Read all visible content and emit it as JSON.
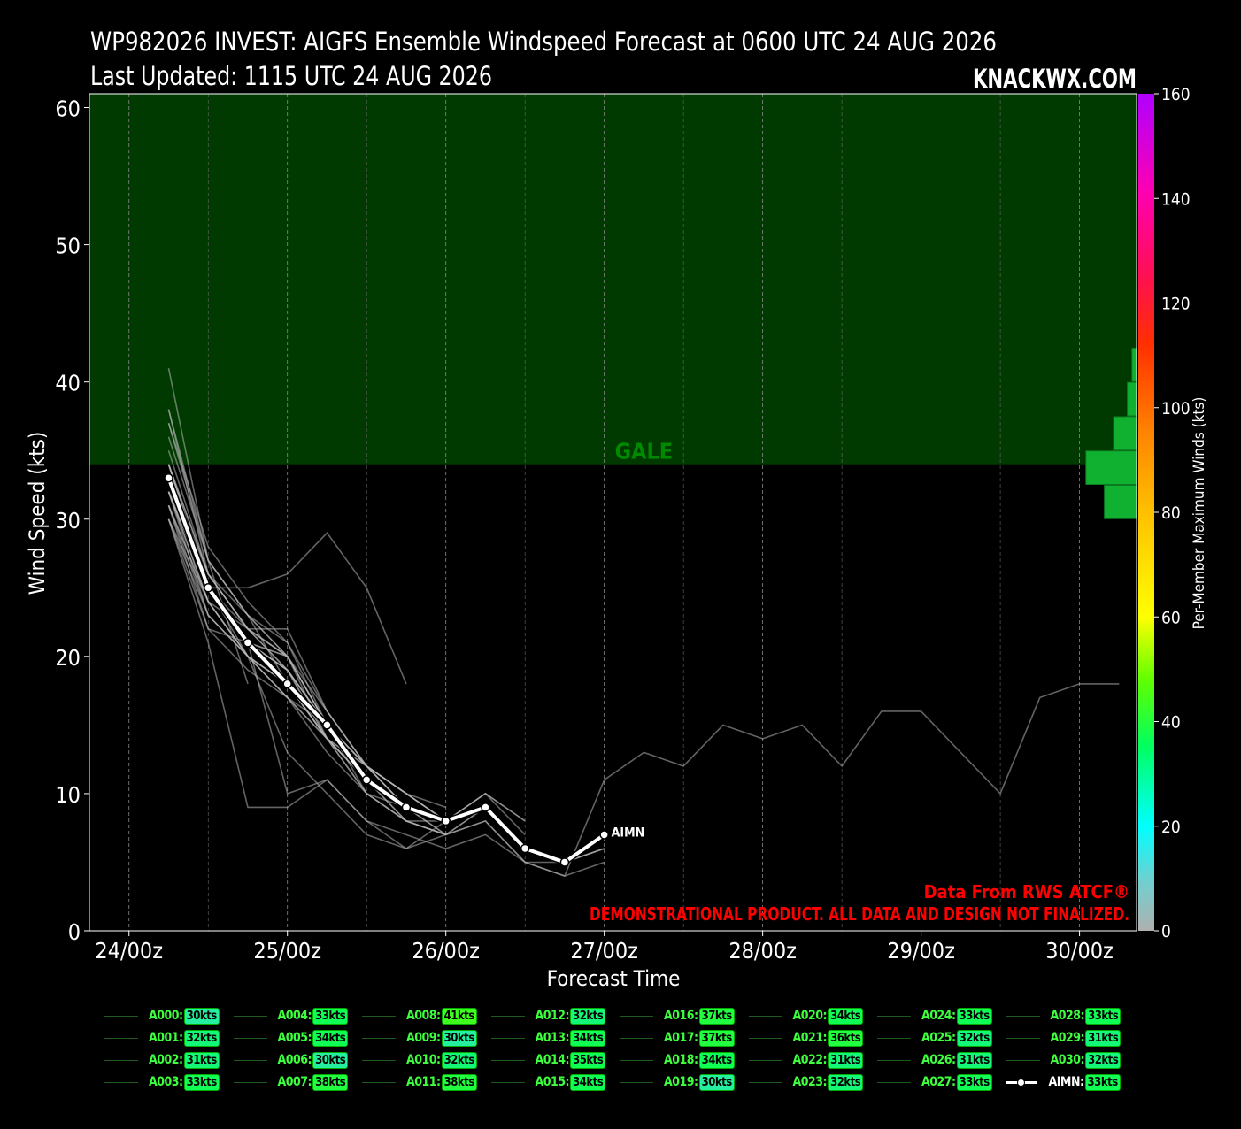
{
  "title_line1": "WP982026 INVEST: AIGFS Ensemble Windspeed Forecast at 0600 UTC 24 AUG 2026",
  "title_line2": "Last Updated: 1115 UTC 24 AUG 2026",
  "brand": "KNACKWX.COM",
  "watermark_line1": "Data From RWS ATCF®",
  "watermark_line2": "DEMONSTRATIONAL PRODUCT. ALL DATA AND DESIGN NOT FINALIZED.",
  "band_label": "GALE",
  "mean_label": "AIMN",
  "colors": {
    "gale_band": "#003a00",
    "gale_text": "#008a00",
    "watermark": "#ff0000",
    "member_line": "#b4b4b4",
    "mean_line": "#ffffff",
    "hist_bar": "#10b030"
  },
  "chart_data": {
    "type": "line",
    "xlabel": "Forecast Time",
    "ylabel": "Wind Speed (kts)",
    "xlim": [
      -0.25,
      6.36
    ],
    "ylim": [
      0,
      61
    ],
    "xticks": [
      0,
      1,
      2,
      3,
      4,
      5,
      6
    ],
    "xtick_labels": [
      "24/00z",
      "25/00z",
      "26/00z",
      "27/00z",
      "28/00z",
      "29/00z",
      "30/00z"
    ],
    "yticks": [
      0,
      10,
      20,
      30,
      40,
      50,
      60
    ],
    "ytick_labels": [
      "0",
      "10",
      "20",
      "30",
      "40",
      "50",
      "60"
    ],
    "grid": true,
    "x_step_days": 0.25,
    "x_first": 0.25,
    "gale_band": [
      34,
      61
    ],
    "colorbar": {
      "label": "Per-Member Maximum Winds (kts)",
      "range": [
        0,
        160
      ],
      "ticks": [
        0,
        20,
        40,
        60,
        80,
        100,
        120,
        140,
        160
      ]
    },
    "histogram": {
      "bins": [
        [
          30,
          32.5
        ],
        [
          32.5,
          35
        ],
        [
          35,
          37.5
        ],
        [
          37.5,
          40
        ],
        [
          40,
          42.5
        ]
      ],
      "counts": [
        7,
        11,
        5,
        2,
        1
      ]
    },
    "members": [
      {
        "name": "A000",
        "max": "30kts",
        "values": [
          30,
          22,
          19,
          17,
          15,
          12,
          10,
          8
        ]
      },
      {
        "name": "A001",
        "max": "32kts",
        "values": [
          32,
          25,
          21,
          19,
          15,
          12,
          10,
          8
        ]
      },
      {
        "name": "A002",
        "max": "31kts",
        "values": [
          31,
          24,
          20,
          18,
          14,
          11,
          9,
          8,
          9,
          6,
          5,
          7
        ]
      },
      {
        "name": "A003",
        "max": "33kts",
        "values": [
          33,
          25,
          21,
          20,
          16,
          12,
          9,
          7
        ]
      },
      {
        "name": "A004",
        "max": "33kts",
        "values": [
          33,
          26,
          22,
          20,
          15,
          11,
          8,
          8
        ]
      },
      {
        "name": "A005",
        "max": "34kts",
        "values": [
          34,
          25,
          22,
          20,
          15,
          10,
          9,
          8
        ]
      },
      {
        "name": "A006",
        "max": "30kts",
        "values": [
          30,
          21,
          9,
          9,
          11,
          8,
          6,
          8
        ]
      },
      {
        "name": "A007",
        "max": "38kts",
        "values": [
          38,
          26,
          22,
          19,
          14,
          10,
          8,
          7,
          8,
          5,
          5,
          6
        ]
      },
      {
        "name": "A008",
        "max": "41kts",
        "values": [
          41,
          27,
          18
        ]
      },
      {
        "name": "A009",
        "max": "30kts",
        "values": [
          30,
          24,
          22,
          22,
          16,
          12,
          10,
          8
        ]
      },
      {
        "name": "A010",
        "max": "32kts",
        "values": [
          32,
          25,
          21,
          20,
          15,
          11,
          9,
          8,
          10,
          7
        ]
      },
      {
        "name": "A011",
        "max": "38kts",
        "values": [
          38,
          27,
          23,
          18,
          14,
          10,
          8,
          7,
          9,
          6,
          5,
          6
        ]
      },
      {
        "name": "A012",
        "max": "32kts",
        "values": [
          32,
          25,
          21,
          19,
          14,
          11,
          9,
          8
        ]
      },
      {
        "name": "A013",
        "max": "34kts",
        "values": [
          34,
          26,
          22,
          20,
          15,
          12,
          10,
          8
        ]
      },
      {
        "name": "A014",
        "max": "35kts",
        "values": [
          35,
          26,
          23,
          21,
          16,
          12,
          9,
          7
        ]
      },
      {
        "name": "A015",
        "max": "34kts",
        "values": [
          34,
          25,
          21,
          19,
          15,
          11,
          8,
          7,
          9,
          6,
          5,
          6
        ]
      },
      {
        "name": "A016",
        "max": "37kts",
        "values": [
          37,
          28,
          24,
          21,
          15,
          11,
          9,
          8
        ]
      },
      {
        "name": "A017",
        "max": "37kts",
        "values": [
          37,
          27,
          23,
          20,
          15,
          11,
          9,
          8
        ]
      },
      {
        "name": "A018",
        "max": "34kts",
        "values": [
          34,
          25,
          21,
          18,
          14,
          12,
          9,
          8,
          10,
          8
        ]
      },
      {
        "name": "A019",
        "max": "30kts",
        "values": [
          30,
          23,
          20,
          17,
          13,
          10,
          8,
          7
        ]
      },
      {
        "name": "A020",
        "max": "34kts",
        "values": [
          34,
          26,
          22,
          19,
          15,
          12,
          9,
          8
        ]
      },
      {
        "name": "A021",
        "max": "36kts",
        "values": [
          36,
          27,
          23,
          20,
          14,
          12,
          10,
          9
        ]
      },
      {
        "name": "A022",
        "max": "31kts",
        "values": [
          31,
          24,
          20,
          18,
          14,
          11,
          9,
          8
        ]
      },
      {
        "name": "A023",
        "max": "32kts",
        "values": [
          32,
          23,
          20,
          13,
          10,
          7,
          6,
          7,
          8,
          5,
          4,
          5
        ]
      },
      {
        "name": "A024",
        "max": "33kts",
        "values": [
          33,
          25,
          20,
          17,
          14,
          11,
          9,
          8
        ]
      },
      {
        "name": "A025",
        "max": "32kts",
        "values": [
          32,
          24,
          20,
          18,
          14,
          11,
          9,
          8
        ]
      },
      {
        "name": "A026",
        "max": "31kts",
        "values": [
          31,
          22,
          21,
          10,
          11,
          8,
          7,
          6,
          7,
          5,
          4,
          11,
          13,
          12,
          15,
          14,
          15,
          12,
          16,
          16,
          13,
          10,
          17,
          18,
          18
        ]
      },
      {
        "name": "A027",
        "max": "33kts",
        "values": [
          33,
          25,
          25,
          26,
          29,
          25,
          18
        ]
      },
      {
        "name": "A028",
        "max": "33kts",
        "values": [
          33,
          25,
          21,
          19,
          15,
          12,
          10,
          8
        ]
      },
      {
        "name": "A029",
        "max": "31kts",
        "values": [
          31,
          23,
          20,
          17,
          14,
          11,
          9,
          8,
          10,
          8
        ]
      },
      {
        "name": "A030",
        "max": "32kts",
        "values": [
          32,
          24,
          20,
          18,
          14,
          11,
          9,
          8
        ]
      }
    ],
    "mean": {
      "name": "AIMN",
      "max": "33kts",
      "values": [
        33,
        25,
        21,
        18,
        15,
        11,
        9,
        8,
        9,
        6,
        5,
        7
      ]
    }
  }
}
